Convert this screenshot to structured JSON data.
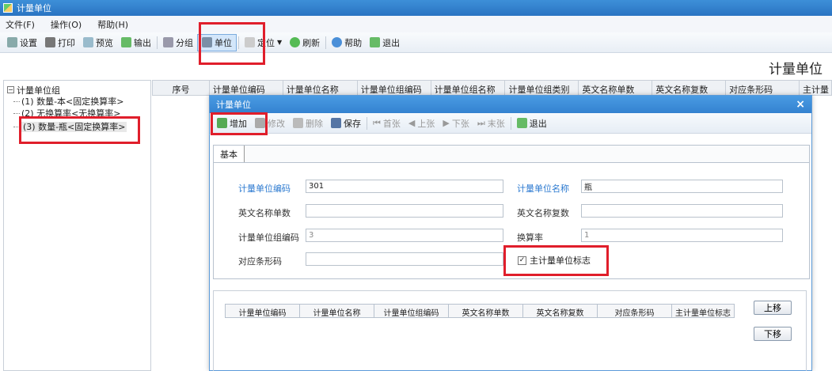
{
  "window": {
    "title": "计量单位"
  },
  "menu": [
    "文件(F)",
    "操作(O)",
    "帮助(H)"
  ],
  "toolbar": {
    "settings": "设置",
    "print": "打印",
    "preview": "预览",
    "export": "输出",
    "group": "分组",
    "unit": "单位",
    "locate": "定位",
    "refresh": "刷新",
    "help": "帮助",
    "exit": "退出"
  },
  "page_heading": "计量单位",
  "tree": {
    "root": "计量单位组",
    "items": [
      "(1) 数量-本<固定换算率>",
      "(2) 无换算率<无换算率>",
      "(3) 数量-瓶<固定换算率>"
    ]
  },
  "grid_columns": [
    "序号",
    "计量单位编码",
    "计量单位名称",
    "计量单位组编码",
    "计量单位组名称",
    "计量单位组类别",
    "英文名称单数",
    "英文名称复数",
    "对应条形码",
    "主计量"
  ],
  "dialog": {
    "title": "计量单位",
    "close": "×",
    "toolbar": {
      "add": "增加",
      "edit": "修改",
      "delete": "删除",
      "save": "保存",
      "first": "首张",
      "prev": "上张",
      "next": "下张",
      "last": "末张",
      "exit": "退出"
    },
    "tab": "基本",
    "form": {
      "unit_code_label": "计量单位编码",
      "unit_code_value": "301",
      "unit_name_label": "计量单位名称",
      "unit_name_value": "瓶",
      "en_singular_label": "英文名称单数",
      "en_singular_value": "",
      "en_plural_label": "英文名称复数",
      "en_plural_value": "",
      "group_code_label": "计量单位组编码",
      "group_code_value": "3",
      "rate_label": "换算率",
      "rate_value": "1",
      "barcode_label": "对应条形码",
      "barcode_value": "",
      "main_unit_label": "主计量单位标志",
      "main_unit_checked": "✓"
    },
    "sub_grid_columns": [
      "计量单位编码",
      "计量单位名称",
      "计量单位组编码",
      "英文名称单数",
      "英文名称复数",
      "对应条形码",
      "主计量单位标志"
    ],
    "move_up": "上移",
    "move_down": "下移"
  },
  "colors": {
    "titlebar": "#2a74c2",
    "highlight": "#e01e2b",
    "required_label": "#2c7ad0"
  }
}
